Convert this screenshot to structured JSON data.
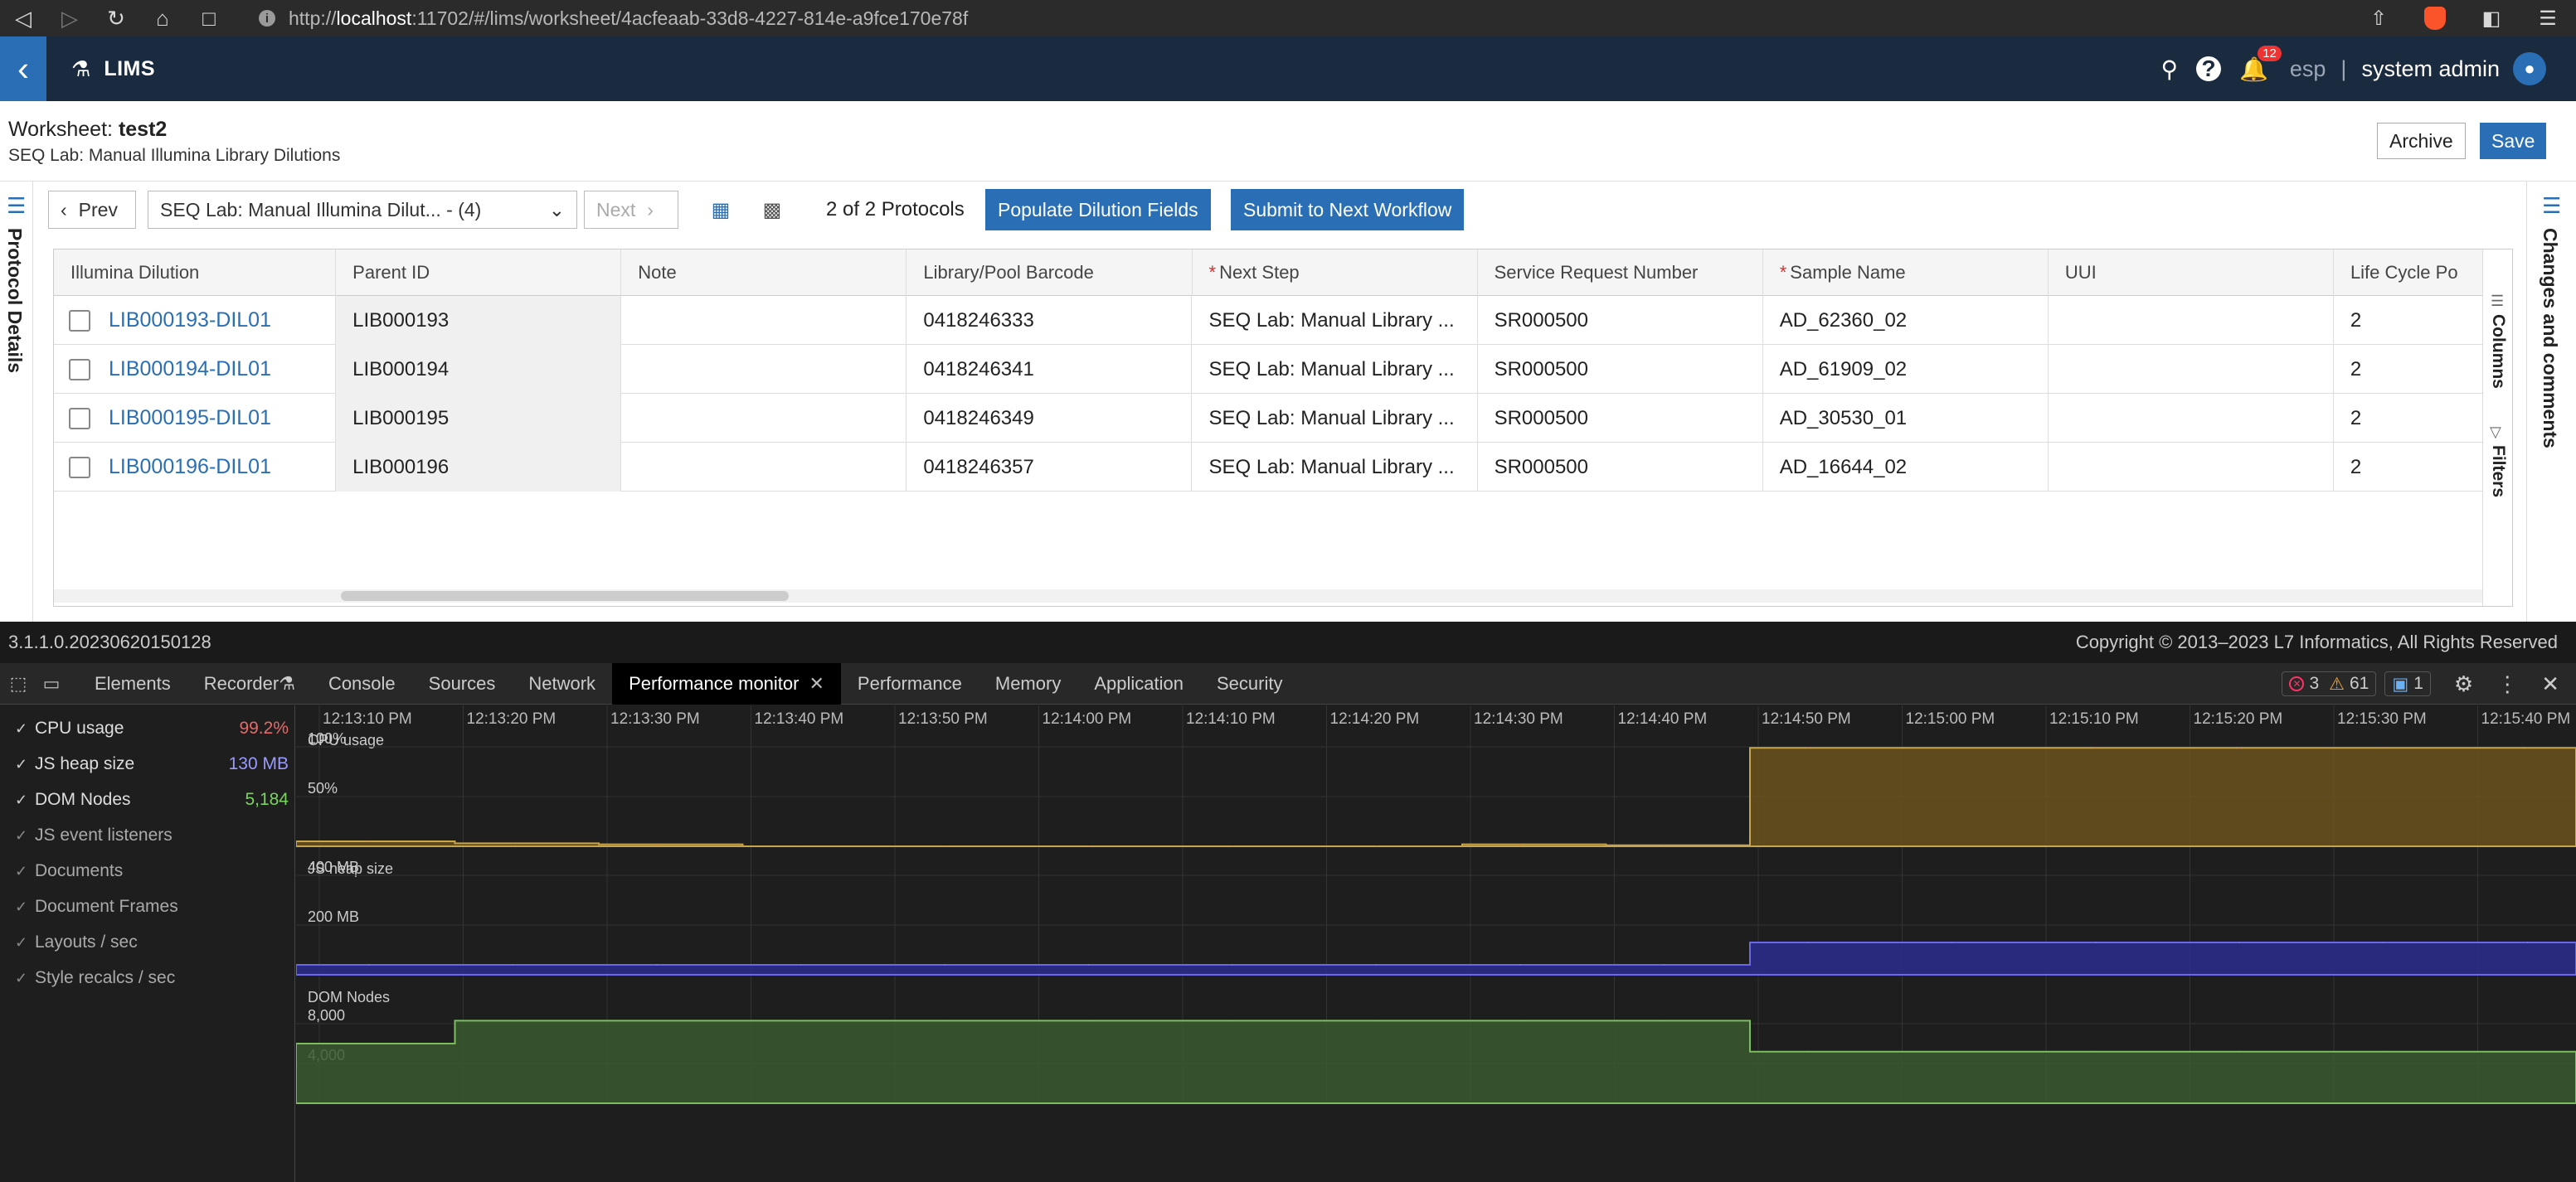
{
  "browser": {
    "url_prefix": "http://",
    "url_host": "localhost",
    "url_rest": ":11702/#/lims/worksheet/4acfeaab-33d8-4227-814e-a9fce170e78f"
  },
  "app": {
    "name": "LIMS",
    "notification_count": "12",
    "language": "esp",
    "user_name": "system admin"
  },
  "worksheet": {
    "label": "Worksheet: ",
    "name": "test2",
    "subtitle": "SEQ Lab: Manual Illumina Library Dilutions",
    "archive_label": "Archive",
    "save_label": "Save",
    "left_rail_label": "Protocol Details",
    "right_rail_label": "Changes and comments"
  },
  "toolbar": {
    "prev_label": "Prev",
    "protocol_select": "SEQ Lab: Manual Illumina Dilut... - (4)",
    "next_label": "Next",
    "protocol_count": "2 of 2 Protocols",
    "populate_label": "Populate Dilution Fields",
    "submit_label": "Submit to Next Workflow"
  },
  "grid": {
    "columns": [
      {
        "label": "Illumina Dilution",
        "required": false
      },
      {
        "label": "Parent ID",
        "required": false
      },
      {
        "label": "Note",
        "required": false
      },
      {
        "label": "Library/Pool Barcode",
        "required": false
      },
      {
        "label": "Next Step",
        "required": true
      },
      {
        "label": "Service Request Number",
        "required": false
      },
      {
        "label": "Sample Name",
        "required": true
      },
      {
        "label": "UUI",
        "required": false
      },
      {
        "label": "Life Cycle Po",
        "required": false
      }
    ],
    "rows": [
      {
        "dilution": "LIB000193-DIL01",
        "parent": "LIB000193",
        "note": "",
        "barcode": "0418246333",
        "next_step": "SEQ Lab: Manual Library ...",
        "srn": "SR000500",
        "sample": "AD_62360_02",
        "uui": "",
        "lifecycle": "2"
      },
      {
        "dilution": "LIB000194-DIL01",
        "parent": "LIB000194",
        "note": "",
        "barcode": "0418246341",
        "next_step": "SEQ Lab: Manual Library ...",
        "srn": "SR000500",
        "sample": "AD_61909_02",
        "uui": "",
        "lifecycle": "2"
      },
      {
        "dilution": "LIB000195-DIL01",
        "parent": "LIB000195",
        "note": "",
        "barcode": "0418246349",
        "next_step": "SEQ Lab: Manual Library ...",
        "srn": "SR000500",
        "sample": "AD_30530_01",
        "uui": "",
        "lifecycle": "2"
      },
      {
        "dilution": "LIB000196-DIL01",
        "parent": "LIB000196",
        "note": "",
        "barcode": "0418246357",
        "next_step": "SEQ Lab: Manual Library ...",
        "srn": "SR000500",
        "sample": "AD_16644_02",
        "uui": "",
        "lifecycle": "2"
      }
    ],
    "side_columns_label": "Columns",
    "side_filters_label": "Filters"
  },
  "footer": {
    "version": "3.1.1.0.20230620150128",
    "copyright": "Copyright © 2013–2023 L7 Informatics, All Rights Reserved"
  },
  "devtools": {
    "tabs": [
      "Elements",
      "Recorder",
      "Console",
      "Sources",
      "Network",
      "Performance monitor",
      "Performance",
      "Memory",
      "Application",
      "Security"
    ],
    "active_tab": "Performance monitor",
    "errors": "3",
    "warnings": "61",
    "messages": "1",
    "metrics": [
      {
        "name": "CPU usage",
        "value": "99.2%",
        "color": "#e46a6a",
        "checked": true
      },
      {
        "name": "JS heap size",
        "value": "130 MB",
        "color": "#9a9aff",
        "checked": true
      },
      {
        "name": "DOM Nodes",
        "value": "5,184",
        "color": "#7bd35f",
        "checked": true
      },
      {
        "name": "JS event listeners",
        "value": "",
        "color": "",
        "checked": false
      },
      {
        "name": "Documents",
        "value": "",
        "color": "",
        "checked": false
      },
      {
        "name": "Document Frames",
        "value": "",
        "color": "",
        "checked": false
      },
      {
        "name": "Layouts / sec",
        "value": "",
        "color": "",
        "checked": false
      },
      {
        "name": "Style recalcs / sec",
        "value": "",
        "color": "",
        "checked": false
      }
    ],
    "time_ticks": [
      "12:13:10 PM",
      "12:13:20 PM",
      "12:13:30 PM",
      "12:13:40 PM",
      "12:13:50 PM",
      "12:14:00 PM",
      "12:14:10 PM",
      "12:14:20 PM",
      "12:14:30 PM",
      "12:14:40 PM",
      "12:14:50 PM",
      "12:15:00 PM",
      "12:15:10 PM",
      "12:15:20 PM",
      "12:15:30 PM",
      "12:15:40 PM"
    ],
    "cpu_label": "CPU usage",
    "cpu_ticks": [
      "100%",
      "50%"
    ],
    "heap_label": "JS heap size",
    "heap_ticks": [
      "400 MB",
      "200 MB"
    ],
    "dom_label": "DOM Nodes",
    "dom_ticks": [
      "8,000",
      "4,000"
    ]
  },
  "chart_data": [
    {
      "type": "area",
      "title": "CPU usage",
      "ylim": [
        0,
        100
      ],
      "x": [
        "12:13:10 PM",
        "12:13:20 PM",
        "12:13:30 PM",
        "12:13:40 PM",
        "12:13:50 PM",
        "12:14:00 PM",
        "12:14:10 PM",
        "12:14:20 PM",
        "12:14:30 PM",
        "12:14:40 PM",
        "12:14:50 PM",
        "12:15:00 PM",
        "12:15:10 PM",
        "12:15:20 PM",
        "12:15:30 PM",
        "12:15:40 PM"
      ],
      "series": [
        {
          "name": "CPU usage",
          "values": [
            5,
            3,
            2,
            0,
            0,
            0,
            0,
            0,
            2,
            1,
            99,
            99,
            99,
            99,
            99,
            99
          ]
        }
      ]
    },
    {
      "type": "area",
      "title": "JS heap size",
      "ylim": [
        0,
        400
      ],
      "x": [
        "12:13:10 PM",
        "12:13:20 PM",
        "12:13:30 PM",
        "12:13:40 PM",
        "12:13:50 PM",
        "12:14:00 PM",
        "12:14:10 PM",
        "12:14:20 PM",
        "12:14:30 PM",
        "12:14:40 PM",
        "12:14:50 PM",
        "12:15:00 PM",
        "12:15:10 PM",
        "12:15:20 PM",
        "12:15:30 PM",
        "12:15:40 PM"
      ],
      "series": [
        {
          "name": "JS heap size",
          "values": [
            40,
            40,
            40,
            40,
            40,
            40,
            40,
            40,
            40,
            40,
            130,
            130,
            130,
            130,
            130,
            130
          ]
        }
      ]
    },
    {
      "type": "area",
      "title": "DOM Nodes",
      "ylim": [
        0,
        10000
      ],
      "x": [
        "12:13:10 PM",
        "12:13:20 PM",
        "12:13:30 PM",
        "12:13:40 PM",
        "12:13:50 PM",
        "12:14:00 PM",
        "12:14:10 PM",
        "12:14:20 PM",
        "12:14:30 PM",
        "12:14:40 PM",
        "12:14:50 PM",
        "12:15:00 PM",
        "12:15:10 PM",
        "12:15:20 PM",
        "12:15:30 PM",
        "12:15:40 PM"
      ],
      "series": [
        {
          "name": "DOM Nodes",
          "values": [
            6000,
            8300,
            8300,
            8300,
            8300,
            8300,
            8300,
            8300,
            8300,
            8300,
            5184,
            5184,
            5184,
            5184,
            5184,
            5184
          ]
        }
      ]
    }
  ]
}
